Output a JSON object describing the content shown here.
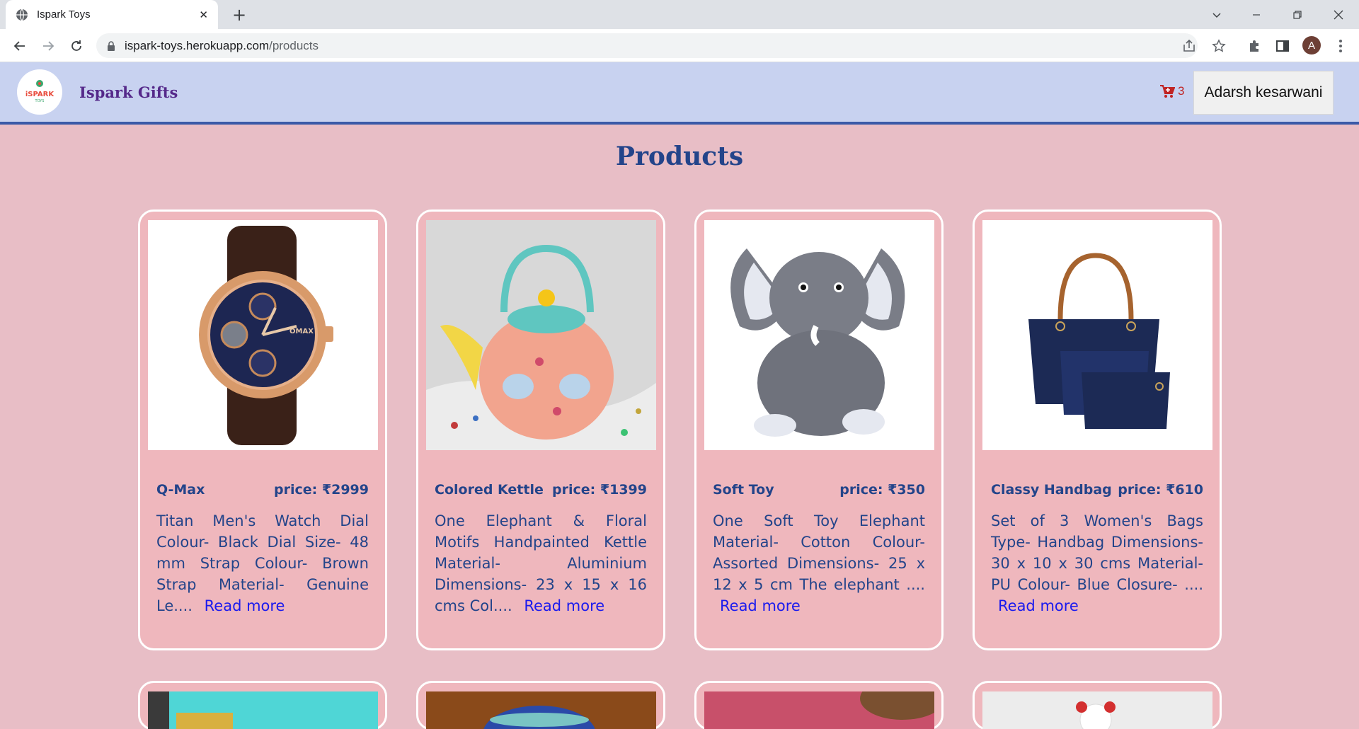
{
  "browser": {
    "tab_title": "Ispark Toys",
    "url_domain": "ispark-toys.herokuapp.com",
    "url_path": "/products",
    "profile_initial": "A"
  },
  "header": {
    "brand": "Ispark Gifts",
    "logo_text": "iSPARK",
    "cart_count": "3",
    "user_name": "Adarsh kesarwani"
  },
  "page_title": "Products",
  "products": [
    {
      "name": "Q-Max",
      "price": "price: ₹2999",
      "description": "Titan Men's Watch Dial Colour- Black Dial Size- 48 mm Strap Colour- Brown Strap Material- Genuine Le....",
      "read_more": "Read more",
      "image": "watch"
    },
    {
      "name": "Colored Kettle",
      "price": "price: ₹1399",
      "description": "One Elephant & Floral Motifs Handpainted Kettle Material- Aluminium Dimensions- 23 x 15 x 16 cms Col....",
      "read_more": "Read more",
      "image": "kettle"
    },
    {
      "name": "Soft Toy",
      "price": "price: ₹350",
      "description": "One Soft Toy Elephant Material- Cotton Colour- Assorted Dimensions- 25 x 12 x 5 cm The elephant ....",
      "read_more": "Read more",
      "image": "elephant"
    },
    {
      "name": "Classy Handbag",
      "price": "price: ₹610",
      "description": "Set of 3 Women's Bags Type- Handbag Dimensions- 30 x 10 x 30 cms Material- PU Colour- Blue Closure- ....",
      "read_more": "Read more",
      "image": "handbag"
    }
  ],
  "colors": {
    "page_bg": "#e8bec6",
    "card_bg": "#efb7bd",
    "header_bg": "#c8d2f0",
    "title": "#23448a",
    "link": "#1a1aee",
    "brand": "#55298a"
  }
}
